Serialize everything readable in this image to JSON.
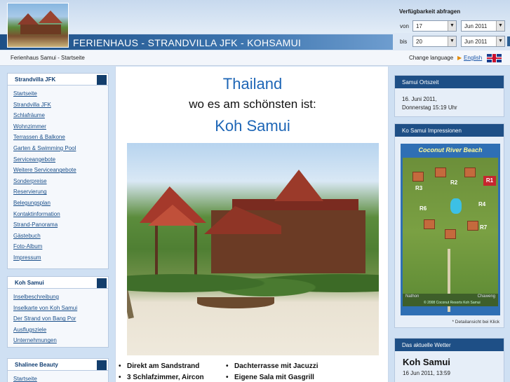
{
  "header": {
    "site_title": "FERIENHAUS - STRANDVILLA JFK - KOHSAMUI",
    "availability": {
      "title": "Verfügbarkeit abfragen",
      "from_label": "von",
      "from_day": "17",
      "from_month": "Jun 2011",
      "to_label": "bis",
      "to_day": "20",
      "to_month": "Jun 2011"
    }
  },
  "breadcrumb": "Ferienhaus Samui - Startseite",
  "language": {
    "label": "Change language",
    "link": "English"
  },
  "sidebar": [
    {
      "title": "Strandvilla JFK",
      "items": [
        "Startseite",
        "Strandvilla JFK",
        "Schlafräume",
        "Wohnzimmer",
        "Terrassen & Balkone",
        "Garten & Swimming Pool",
        "Serviceangebote",
        "Weitere Serviceangebote",
        "Sonderpreise",
        "Reservierung",
        "Belegungsplan",
        "Kontaktinformation",
        "Strand-Panorama",
        "Gästebuch",
        "Foto-Album",
        "Impressum"
      ]
    },
    {
      "title": "Koh Samui",
      "items": [
        "Inselbeschreibung",
        "Inselkarte von Koh Samui",
        "Der Strand von Bang Por",
        "Ausflugsziele",
        "Unternehmungen"
      ]
    },
    {
      "title": "Shalinee Beauty",
      "items": [
        "Startseite"
      ]
    }
  ],
  "main": {
    "heading1": "Thailand",
    "heading2": "wo es am schönsten ist:",
    "heading3": "Koh Samui",
    "features_left": [
      "Direkt am Sandstrand",
      "3 Schlafzimmer, Aircon"
    ],
    "features_right": [
      "Dachterrasse mit Jacuzzi",
      "Eigene Sala mit Gasgrill"
    ]
  },
  "right": {
    "clock": {
      "title": "Samui Ortszeit",
      "date": "16. Juni 2011,",
      "time": "Donnerstag 15:19 Uhr"
    },
    "impressions": {
      "title": "Ko Samui Impressionen",
      "map_title": "Coconut River Beach",
      "labels": [
        "R1",
        "R2",
        "R3",
        "R4",
        "R6",
        "R7"
      ],
      "left_label": "Nathon",
      "right_label": "Chaweng",
      "copyright": "© 2008 Coconut Resorts Koh Samui",
      "caption": "* Detailansicht bei Klick"
    },
    "weather": {
      "title": "Das aktuelle Wetter",
      "city": "Koh Samui",
      "time": "16 Jun 2011, 13:59"
    }
  }
}
